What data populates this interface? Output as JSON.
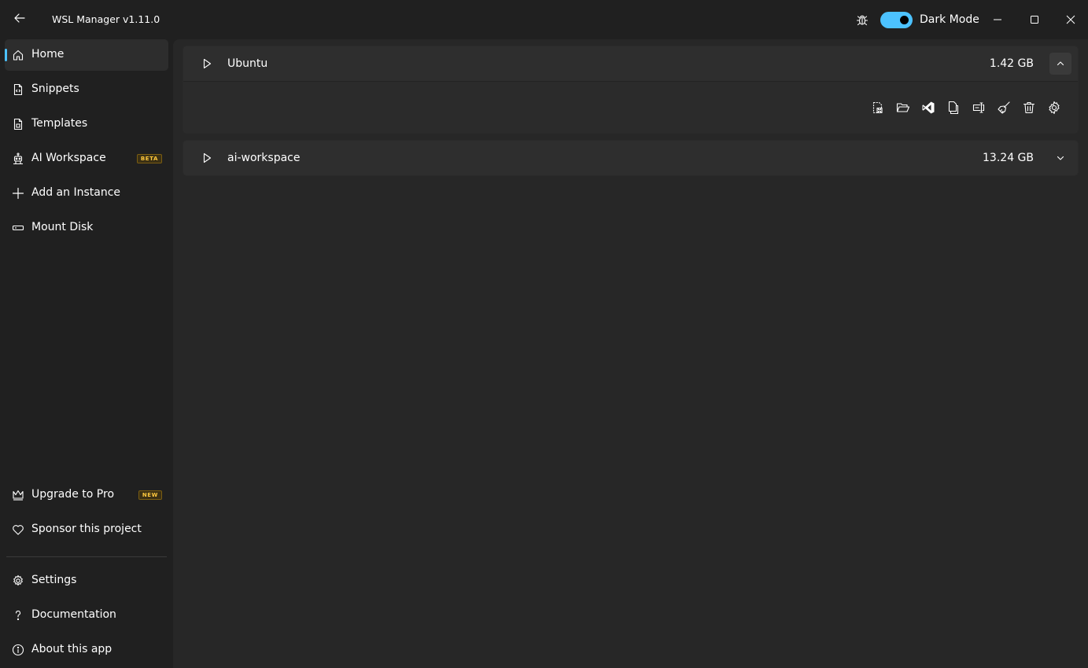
{
  "window": {
    "title": "WSL Manager v1.11.0",
    "theme_toggle_label": "Dark Mode",
    "theme_toggle_on": true
  },
  "icons": {
    "back": "arrow-left-icon",
    "bug": "bug-icon",
    "minimize": "minimize-icon",
    "maximize": "maximize-icon",
    "close": "close-icon"
  },
  "sidebar": {
    "top_items": [
      {
        "label": "Home",
        "icon": "home-icon",
        "active": true
      },
      {
        "label": "Snippets",
        "icon": "snippet-icon"
      },
      {
        "label": "Templates",
        "icon": "template-icon"
      },
      {
        "label": "AI Workspace",
        "icon": "robot-icon",
        "badge": "BETA"
      },
      {
        "label": "Add an Instance",
        "icon": "plus-icon"
      },
      {
        "label": "Mount Disk",
        "icon": "disk-icon"
      }
    ],
    "bottom_items": [
      {
        "label": "Upgrade to Pro",
        "icon": "crown-icon",
        "badge": "NEW"
      },
      {
        "label": "Sponsor this project",
        "icon": "heart-icon"
      },
      {
        "label": "Settings",
        "icon": "gear-icon"
      },
      {
        "label": "Documentation",
        "icon": "question-icon"
      },
      {
        "label": "About this app",
        "icon": "info-icon"
      }
    ]
  },
  "instances": [
    {
      "name": "Ubuntu",
      "size": "1.42 GB",
      "expanded": true,
      "actions": [
        "export-icon",
        "open-folder-icon",
        "vscode-icon",
        "copy-icon",
        "rename-icon",
        "cleanup-icon",
        "delete-icon",
        "settings-icon"
      ]
    },
    {
      "name": "ai-workspace",
      "size": "13.24 GB",
      "expanded": false
    }
  ],
  "colors": {
    "accent": "#4cc2ff",
    "badge_text": "#ffc83d",
    "background": "#202020",
    "content": "#272727",
    "card": "#2e2e2e"
  }
}
